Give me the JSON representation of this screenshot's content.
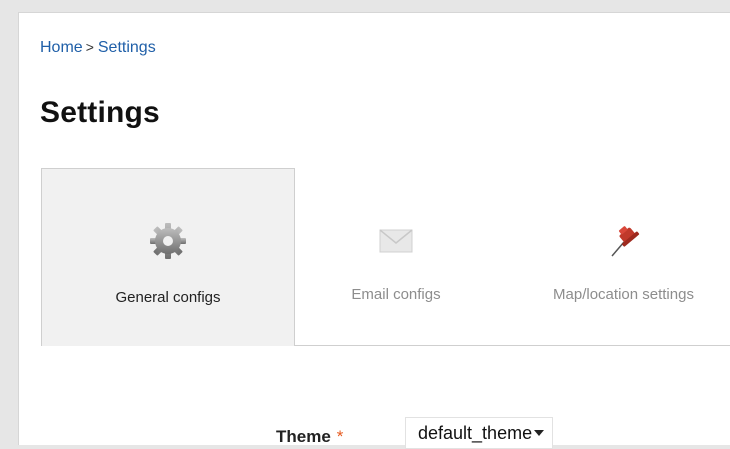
{
  "breadcrumb": {
    "home": "Home",
    "separator": ">",
    "current": "Settings"
  },
  "page": {
    "title": "Settings"
  },
  "tabs": [
    {
      "label": "General configs",
      "icon": "gear-icon",
      "active": true
    },
    {
      "label": "Email configs",
      "icon": "envelope-icon",
      "active": false
    },
    {
      "label": "Map/location settings",
      "icon": "pushpin-icon",
      "active": false
    }
  ],
  "form": {
    "theme": {
      "label": "Theme",
      "required_marker": "*",
      "value": "default_theme"
    }
  },
  "colors": {
    "link": "#1f5fa8",
    "required": "#e65a1f",
    "active_tab_bg": "#f1f1f1"
  }
}
